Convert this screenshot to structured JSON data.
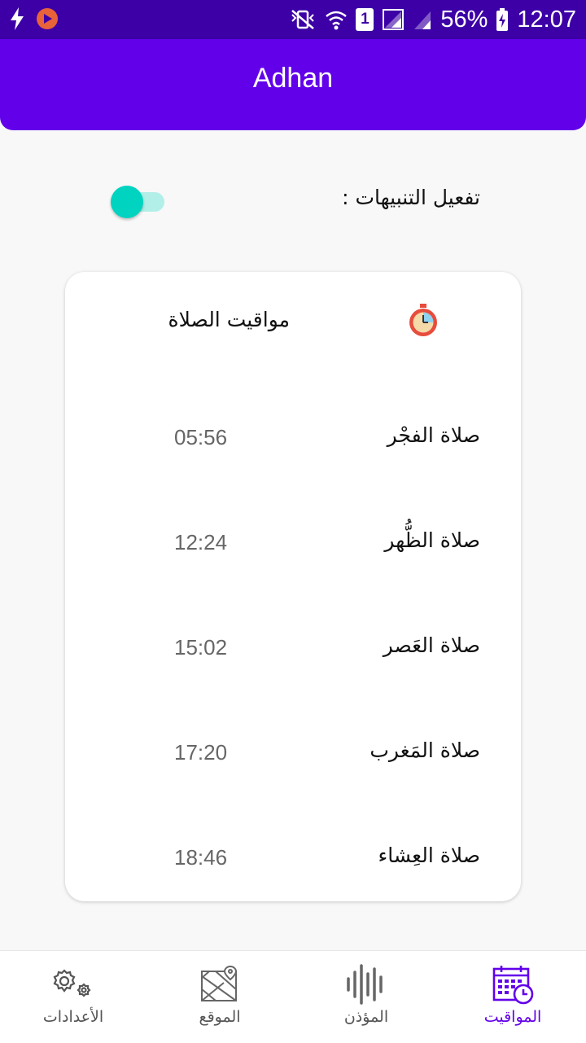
{
  "status_bar": {
    "battery": "56%",
    "time": "12:07",
    "sim_badge": "1"
  },
  "app_bar": {
    "title": "Adhan"
  },
  "notifications": {
    "label": "تفعيل التنبيهات :",
    "enabled": true
  },
  "card": {
    "title": "مواقيت الصلاة",
    "prayers": [
      {
        "name": "صلاة الفجْر",
        "time": "05:56"
      },
      {
        "name": "صلاة الظُّهر",
        "time": "12:24"
      },
      {
        "name": "صلاة العَصر",
        "time": "15:02"
      },
      {
        "name": "صلاة المَغرب",
        "time": "17:20"
      },
      {
        "name": "صلاة العِشاء",
        "time": "18:46"
      }
    ]
  },
  "bottom_nav": {
    "items": [
      {
        "label": "المواقيت",
        "icon": "calendar-clock-icon",
        "active": true
      },
      {
        "label": "المؤذن",
        "icon": "audio-wave-icon",
        "active": false
      },
      {
        "label": "الموقع",
        "icon": "map-icon",
        "active": false
      },
      {
        "label": "الأعدادات",
        "icon": "settings-icon",
        "active": false
      }
    ]
  },
  "colors": {
    "status_bar": "#3c00a6",
    "primary": "#6200ea",
    "toggle_accent": "#00d4c0",
    "background": "#f8f8f8"
  }
}
